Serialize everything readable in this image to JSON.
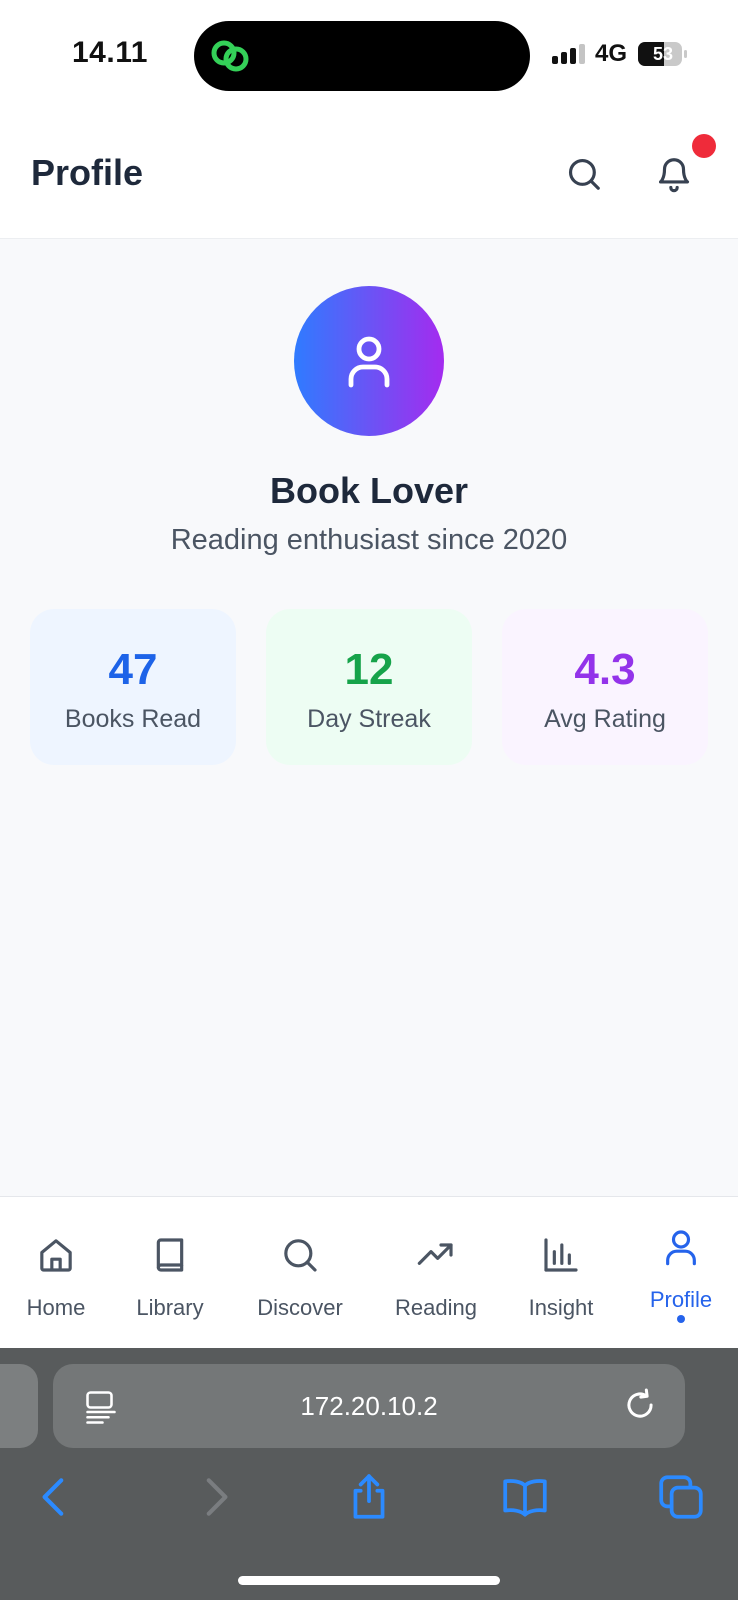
{
  "status_bar": {
    "time": "14.11",
    "network": "4G",
    "battery": "53"
  },
  "header": {
    "title": "Profile",
    "search_icon": "search-icon",
    "bell_icon": "bell-icon"
  },
  "profile": {
    "name": "Book Lover",
    "tagline": "Reading enthusiast since 2020",
    "stats": [
      {
        "value": "47",
        "label": "Books Read",
        "color": "#1d63e8",
        "bg": "#eef5ff"
      },
      {
        "value": "12",
        "label": "Day Streak",
        "color": "#16a34a",
        "bg": "#edfdf3"
      },
      {
        "value": "4.3",
        "label": "Avg Rating",
        "color": "#9333ea",
        "bg": "#faf4ff"
      }
    ]
  },
  "tabs": [
    {
      "label": "Home",
      "icon": "home-icon"
    },
    {
      "label": "Library",
      "icon": "book-icon"
    },
    {
      "label": "Discover",
      "icon": "search-icon"
    },
    {
      "label": "Reading",
      "icon": "trending-up-icon"
    },
    {
      "label": "Insight",
      "icon": "bar-chart-icon"
    },
    {
      "label": "Profile",
      "icon": "user-icon",
      "active": true
    }
  ],
  "browser": {
    "url": "172.20.10.2"
  },
  "colors": {
    "accent": "#2563eb",
    "notification": "#ef2b3a"
  }
}
